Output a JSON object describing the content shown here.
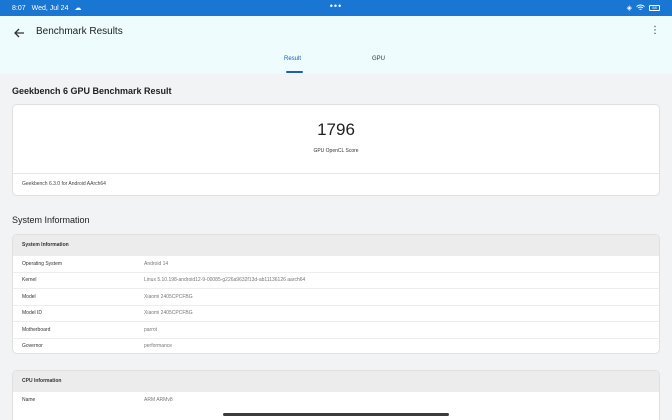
{
  "status_bar": {
    "time": "8:07",
    "date": "Wed, Jul 24",
    "center_dots": "•••",
    "battery": "58"
  },
  "app_bar": {
    "title": "Benchmark Results",
    "tabs": [
      {
        "label": "Result",
        "active": true
      },
      {
        "label": "GPU",
        "active": false
      }
    ]
  },
  "result": {
    "heading": "Geekbench 6 GPU Benchmark Result",
    "score": "1796",
    "score_label": "GPU OpenCL Score",
    "version": "Geekbench 6.3.0 for Android AArch64"
  },
  "system_information": {
    "section_title": "System Information",
    "card_title": "System Information",
    "rows": [
      {
        "key": "Operating System",
        "value": "Android 14"
      },
      {
        "key": "Kernel",
        "value": "Linux 5.10.198-android12-9-00085-g226a9632f13d-ab11136126 aarch64"
      },
      {
        "key": "Model",
        "value": "Xiaomi 2405CPCFBG"
      },
      {
        "key": "Model ID",
        "value": "Xiaomi 2405CPCFBG"
      },
      {
        "key": "Motherboard",
        "value": "parrot"
      },
      {
        "key": "Governor",
        "value": "performance"
      }
    ]
  },
  "cpu_information": {
    "card_title": "CPU Information",
    "rows": [
      {
        "key": "Name",
        "value": "ARM ARMv8"
      }
    ]
  },
  "colors": {
    "status_bar": "#1976d2",
    "app_bar": "#eefcfd",
    "accent": "#1a5fb4",
    "background": "#f1f3f4"
  }
}
